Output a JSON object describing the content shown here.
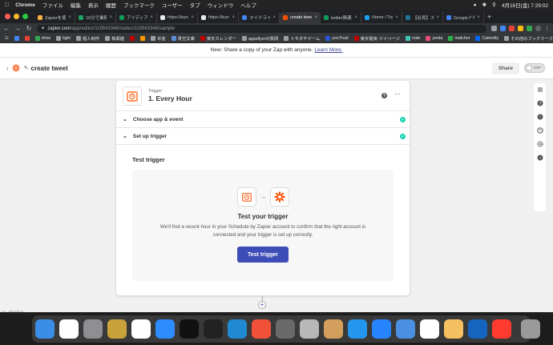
{
  "menubar": {
    "app": "Chrome",
    "menus": [
      "ファイル",
      "編集",
      "表示",
      "履歴",
      "ブックマーク",
      "ユーザー",
      "タブ",
      "ウィンドウ",
      "ヘルプ"
    ],
    "clock": "4月16日(金)  7:29:02"
  },
  "tabs": [
    {
      "title": "Zapierを使",
      "color": "#f6b445"
    },
    {
      "title": "10分で業務自",
      "color": "#1ea362"
    },
    {
      "title": "アイディア各",
      "color": "#0f9d58"
    },
    {
      "title": "https://kuro",
      "color": "#e8eaed"
    },
    {
      "title": "https://kuro",
      "color": "#e8eaed"
    },
    {
      "title": "マイドライブ",
      "color": "#4285f4"
    },
    {
      "title": "create twee",
      "color": "#ff4f00",
      "active": true
    },
    {
      "title": "twitter関連",
      "color": "#0f9d58"
    },
    {
      "title": "Home / Twi",
      "color": "#1da1f2"
    },
    {
      "title": "【必見】スク",
      "color": "#21759b"
    },
    {
      "title": "Googleドキ",
      "color": "#4285f4"
    }
  ],
  "address": {
    "host": "zapier.com",
    "path": "/app/editor/119543348/nodes/119543348/sample"
  },
  "bookmarks": [
    {
      "label": "",
      "color": "#4285f4"
    },
    {
      "label": "",
      "color": "#ea4335"
    },
    {
      "label": "drive",
      "color": "#34a853"
    },
    {
      "label": "light",
      "color": "#9aa0a6"
    },
    {
      "label": "個人制作",
      "color": "#9aa0a6"
    },
    {
      "label": "株関連",
      "color": "#9aa0a6"
    },
    {
      "label": "",
      "color": "#bf0000"
    },
    {
      "label": "",
      "color": "#ff9900"
    },
    {
      "label": "年金",
      "color": "#9aa0a6"
    },
    {
      "label": "青空文庫",
      "color": "#5b8dd6"
    },
    {
      "label": "楽天カレンダー",
      "color": "#bf0000"
    },
    {
      "label": "appsflyerの質問",
      "color": "#9aa0a6"
    },
    {
      "label": "トモダチゲーム",
      "color": "#9aa0a6"
    },
    {
      "label": "youTrust",
      "color": "#2b57d8"
    },
    {
      "label": "楽天電気-マイページ",
      "color": "#bf0000"
    },
    {
      "label": "note",
      "color": "#41c9b4"
    },
    {
      "label": "yenta",
      "color": "#e84f7a"
    },
    {
      "label": "matcher",
      "color": "#2bb24c"
    },
    {
      "label": "Calendly",
      "color": "#006bff"
    }
  ],
  "bookmarks_other": "その他のブックマーク",
  "banner": {
    "text": "New: Share a copy of your Zap with anyone.",
    "link": "Learn More."
  },
  "header": {
    "zap_name": "create tweet",
    "share_label": "Share",
    "toggle_label": "OFF"
  },
  "step": {
    "label": "Trigger",
    "title": "1. Every Hour",
    "sections": [
      {
        "label": "Choose app & event"
      },
      {
        "label": "Set up trigger"
      }
    ]
  },
  "test": {
    "heading": "Test trigger",
    "title": "Test your trigger",
    "description": "We'll find a recent hour in your Schedule by Zapier account to confirm that the right account is connected and your trigger is set up correctly.",
    "button": "Test trigger"
  },
  "status_url": "ze.../sketch-8",
  "colors": {
    "accent": "#3d4db7",
    "zapier_orange": "#ff4f00",
    "check_green": "#13d0ab"
  },
  "dock": [
    {
      "name": "finder",
      "color": "#3b8ee8"
    },
    {
      "name": "calendar",
      "color": "#ffffff"
    },
    {
      "name": "system-preferences",
      "color": "#8e8e93"
    },
    {
      "name": "notes",
      "color": "#c9a23a"
    },
    {
      "name": "chrome",
      "color": "#ffffff"
    },
    {
      "name": "zoom",
      "color": "#2d8cff"
    },
    {
      "name": "terminal-1",
      "color": "#111111"
    },
    {
      "name": "terminal-2",
      "color": "#222222"
    },
    {
      "name": "vscode",
      "color": "#1f8ad2"
    },
    {
      "name": "swift",
      "color": "#f05138"
    },
    {
      "name": "screenshot",
      "color": "#6a6a6a"
    },
    {
      "name": "database",
      "color": "#b8b8b8"
    },
    {
      "name": "archive",
      "color": "#d2a05c"
    },
    {
      "name": "docker",
      "color": "#2496ed"
    },
    {
      "name": "sourcetree",
      "color": "#2684ff"
    },
    {
      "name": "simulator",
      "color": "#4a90e2"
    },
    {
      "name": "clock",
      "color": "#ffffff"
    },
    {
      "name": "preview",
      "color": "#f5c060"
    },
    {
      "name": "infinity",
      "color": "#1565c0"
    },
    {
      "name": "time",
      "color": "#ff3b30"
    },
    {
      "name": "trash",
      "color": "#9a9a9a"
    }
  ]
}
